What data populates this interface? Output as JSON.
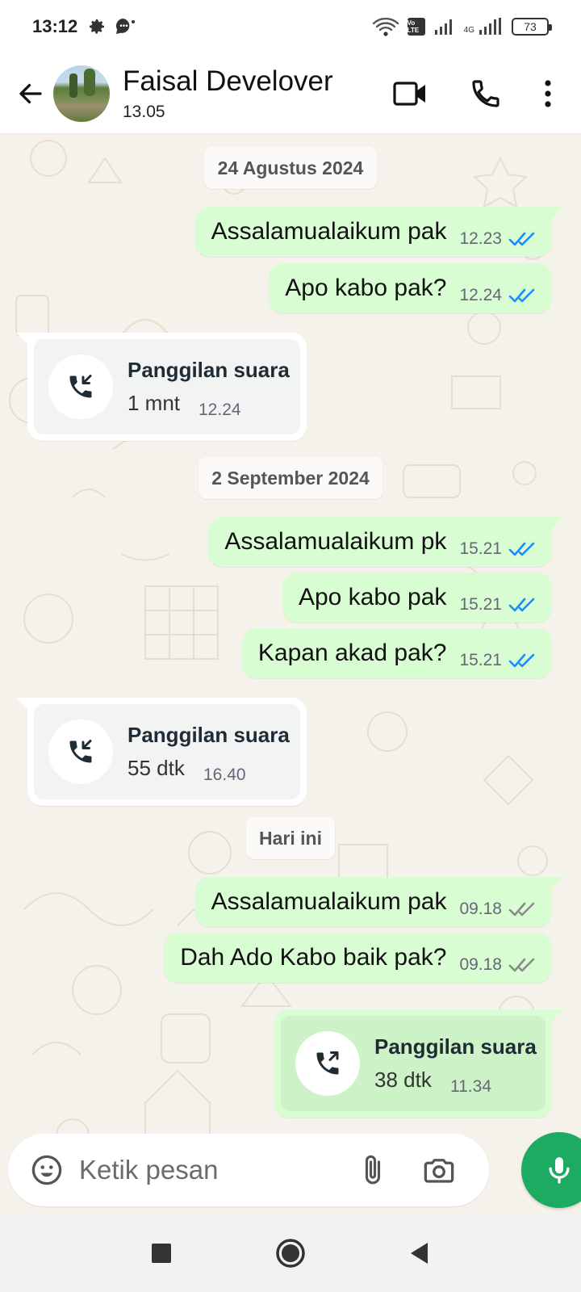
{
  "status_bar": {
    "time": "13:12",
    "network_4g": "4G",
    "volte": "Vo LTE",
    "battery": "73"
  },
  "header": {
    "contact_name": "Faisal Develover",
    "last_seen": "13.05"
  },
  "icons": {
    "back": "arrow-left-icon",
    "video": "video-call-icon",
    "voice": "phone-icon",
    "menu": "more-vertical-icon"
  },
  "chat": {
    "date_1": "24 Agustus 2024",
    "date_2": "2 September 2024",
    "date_3": "Hari ini",
    "messages": [
      {
        "text": "Assalamualaikum pak",
        "time": "12.23",
        "ticks": "read"
      },
      {
        "text": "Apo kabo pak?",
        "time": "12.24",
        "ticks": "read"
      },
      {
        "call_title": "Panggilan suara",
        "call_duration": "1 mnt",
        "time": "12.24",
        "direction": "incoming"
      },
      {
        "text": "Assalamualaikum pk",
        "time": "15.21",
        "ticks": "read"
      },
      {
        "text": "Apo kabo pak",
        "time": "15.21",
        "ticks": "read"
      },
      {
        "text": "Kapan akad pak?",
        "time": "15.21",
        "ticks": "read"
      },
      {
        "call_title": "Panggilan suara",
        "call_duration": "55 dtk",
        "time": "16.40",
        "direction": "incoming"
      },
      {
        "text": "Assalamualaikum pak",
        "time": "09.18",
        "ticks": "delivered"
      },
      {
        "text": "Dah Ado Kabo baik pak?",
        "time": "09.18",
        "ticks": "delivered"
      },
      {
        "call_title": "Panggilan suara",
        "call_duration": "38 dtk",
        "time": "11.34",
        "direction": "outgoing"
      }
    ]
  },
  "composer": {
    "placeholder": "Ketik pesan"
  },
  "colors": {
    "outgoing_bubble": "#d9fdd3",
    "read_tick": "#1a8cff",
    "delivered_tick": "#8a8a8a",
    "mic_button": "#1daa61",
    "chat_background": "#f5f1eb"
  }
}
